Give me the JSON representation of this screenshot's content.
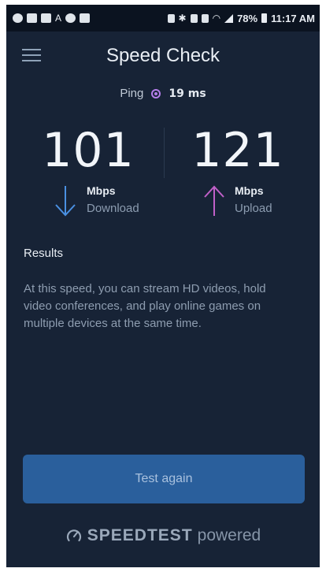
{
  "status_bar": {
    "battery": "78%",
    "time": "11:17 AM"
  },
  "header": {
    "title": "Speed Check"
  },
  "ping": {
    "label": "Ping",
    "value": "19 ms"
  },
  "download": {
    "speed": "101",
    "unit": "Mbps",
    "label": "Download",
    "arrow_color": "#4a90e2"
  },
  "upload": {
    "speed": "121",
    "unit": "Mbps",
    "label": "Upload",
    "arrow_color": "#c060c8"
  },
  "results": {
    "title": "Results",
    "text": "At this speed, you can stream HD videos, hold video conferences, and play online games on multiple devices at the same time."
  },
  "button": {
    "label": "Test again"
  },
  "footer": {
    "brand": "SPEEDTEST",
    "suffix": "powered"
  },
  "colors": {
    "background": "#172336",
    "button": "#2a5f9c",
    "ping_accent": "#b37de8"
  }
}
